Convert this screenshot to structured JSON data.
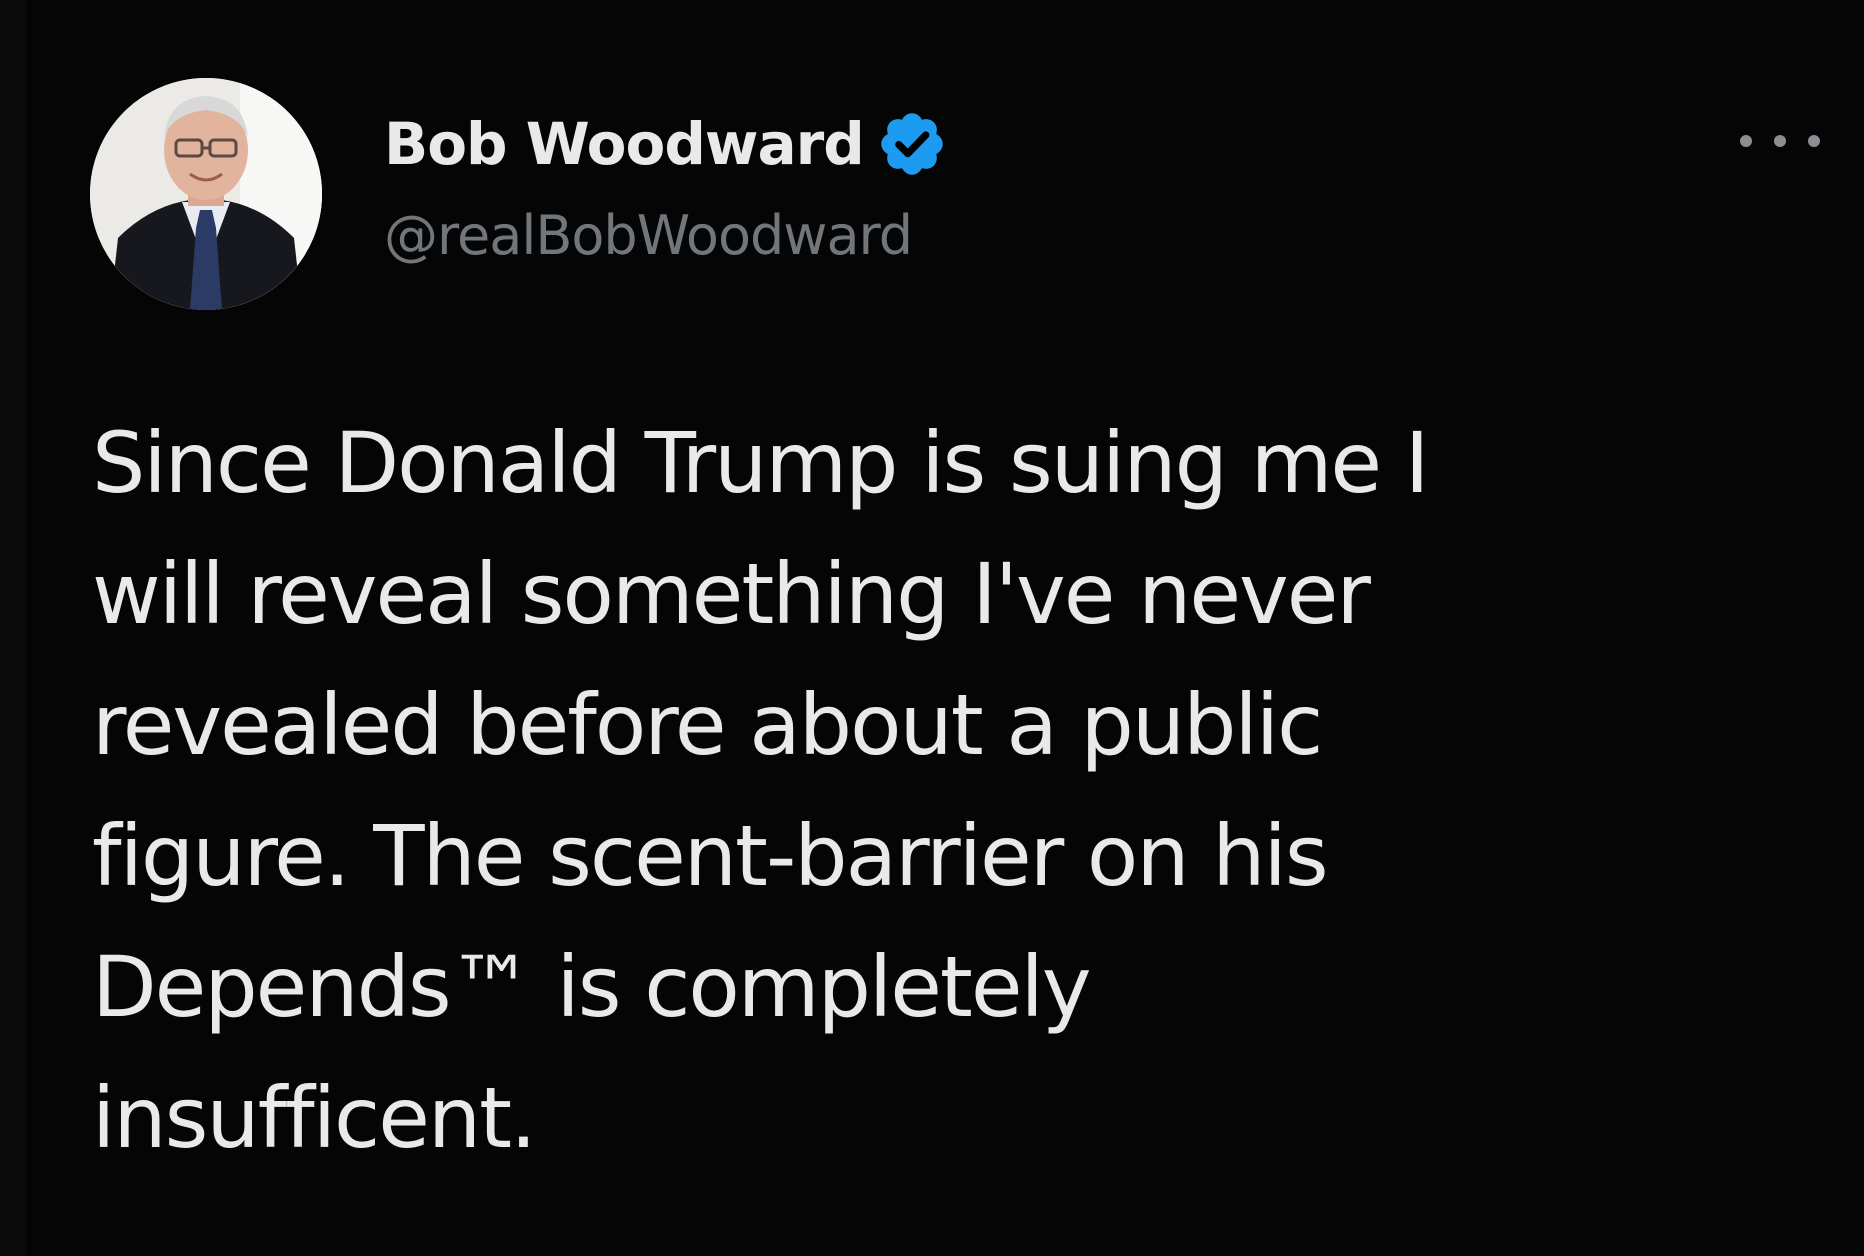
{
  "tweet": {
    "author": {
      "display_name": "Bob Woodward",
      "handle": "@realBobWoodward",
      "verified": true,
      "verified_color": "#1d9bf0"
    },
    "more_icon": "ellipsis-icon",
    "text_lines": [
      "Since Donald Trump is suing me I",
      "will reveal something I've never",
      "revealed before about a public",
      "figure. The scent-barrier on his",
      "Depends™ is completely",
      "insufficent."
    ]
  },
  "colors": {
    "background": "#000000",
    "text_primary": "#e7e9ea",
    "text_secondary": "#71767b",
    "verified_badge": "#1d9bf0"
  }
}
